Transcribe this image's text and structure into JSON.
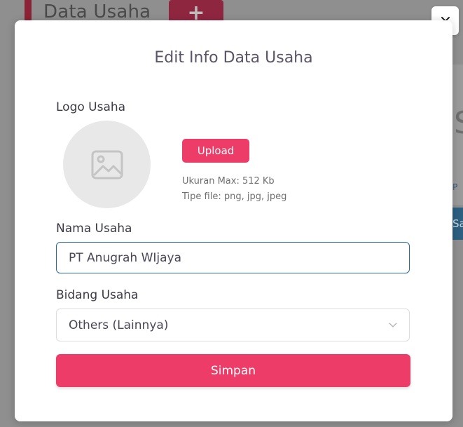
{
  "background": {
    "page_title": "Data Usaha",
    "add_button_icon": "plus-icon",
    "add_button_glyph": "+",
    "right_glyph": "S",
    "right_small_text": "P",
    "right_button_text": "Sa"
  },
  "modal": {
    "title": "Edit Info Data Usaha",
    "close_icon": "close-icon",
    "logo": {
      "label": "Logo Usaha",
      "placeholder_icon": "image-icon",
      "upload_label": "Upload",
      "hint_size": "Ukuran Max: 512 Kb",
      "hint_type": "Tipe file: png, jpg, jpeg"
    },
    "name": {
      "label": "Nama Usaha",
      "value": "PT Anugrah WIjaya"
    },
    "field": {
      "label": "Bidang Usaha",
      "selected": "Others (Lainnya)",
      "chevron_icon": "chevron-down-icon"
    },
    "save_label": "Simpan"
  },
  "colors": {
    "accent": "#ee3c68",
    "input_focus_border": "#2a6a9e",
    "overlay": "#8f8f8f"
  }
}
